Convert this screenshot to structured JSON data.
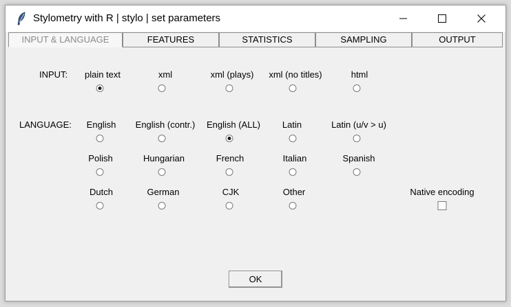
{
  "window": {
    "title": "Stylometry with R | stylo | set parameters",
    "controls": {
      "minimize": "minimize-icon",
      "maximize": "maximize-icon",
      "close": "close-icon"
    }
  },
  "tabs": [
    {
      "label": "INPUT & LANGUAGE",
      "active": true
    },
    {
      "label": "FEATURES",
      "active": false
    },
    {
      "label": "STATISTICS",
      "active": false
    },
    {
      "label": "SAMPLING",
      "active": false
    },
    {
      "label": "OUTPUT",
      "active": false
    }
  ],
  "input": {
    "label": "INPUT:",
    "options": [
      {
        "label": "plain text",
        "selected": true
      },
      {
        "label": "xml",
        "selected": false
      },
      {
        "label": "xml (plays)",
        "selected": false
      },
      {
        "label": "xml (no titles)",
        "selected": false
      },
      {
        "label": "html",
        "selected": false
      }
    ]
  },
  "language": {
    "label": "LANGUAGE:",
    "options": [
      {
        "label": "English",
        "selected": false
      },
      {
        "label": "English (contr.)",
        "selected": false
      },
      {
        "label": "English (ALL)",
        "selected": true
      },
      {
        "label": "Latin",
        "selected": false
      },
      {
        "label": "Latin (u/v > u)",
        "selected": false
      },
      {
        "label": "Polish",
        "selected": false
      },
      {
        "label": "Hungarian",
        "selected": false
      },
      {
        "label": "French",
        "selected": false
      },
      {
        "label": "Italian",
        "selected": false
      },
      {
        "label": "Spanish",
        "selected": false
      },
      {
        "label": "Dutch",
        "selected": false
      },
      {
        "label": "German",
        "selected": false
      },
      {
        "label": "CJK",
        "selected": false
      },
      {
        "label": "Other",
        "selected": false
      }
    ]
  },
  "native_encoding": {
    "label": "Native encoding",
    "checked": false
  },
  "ok_label": "OK"
}
